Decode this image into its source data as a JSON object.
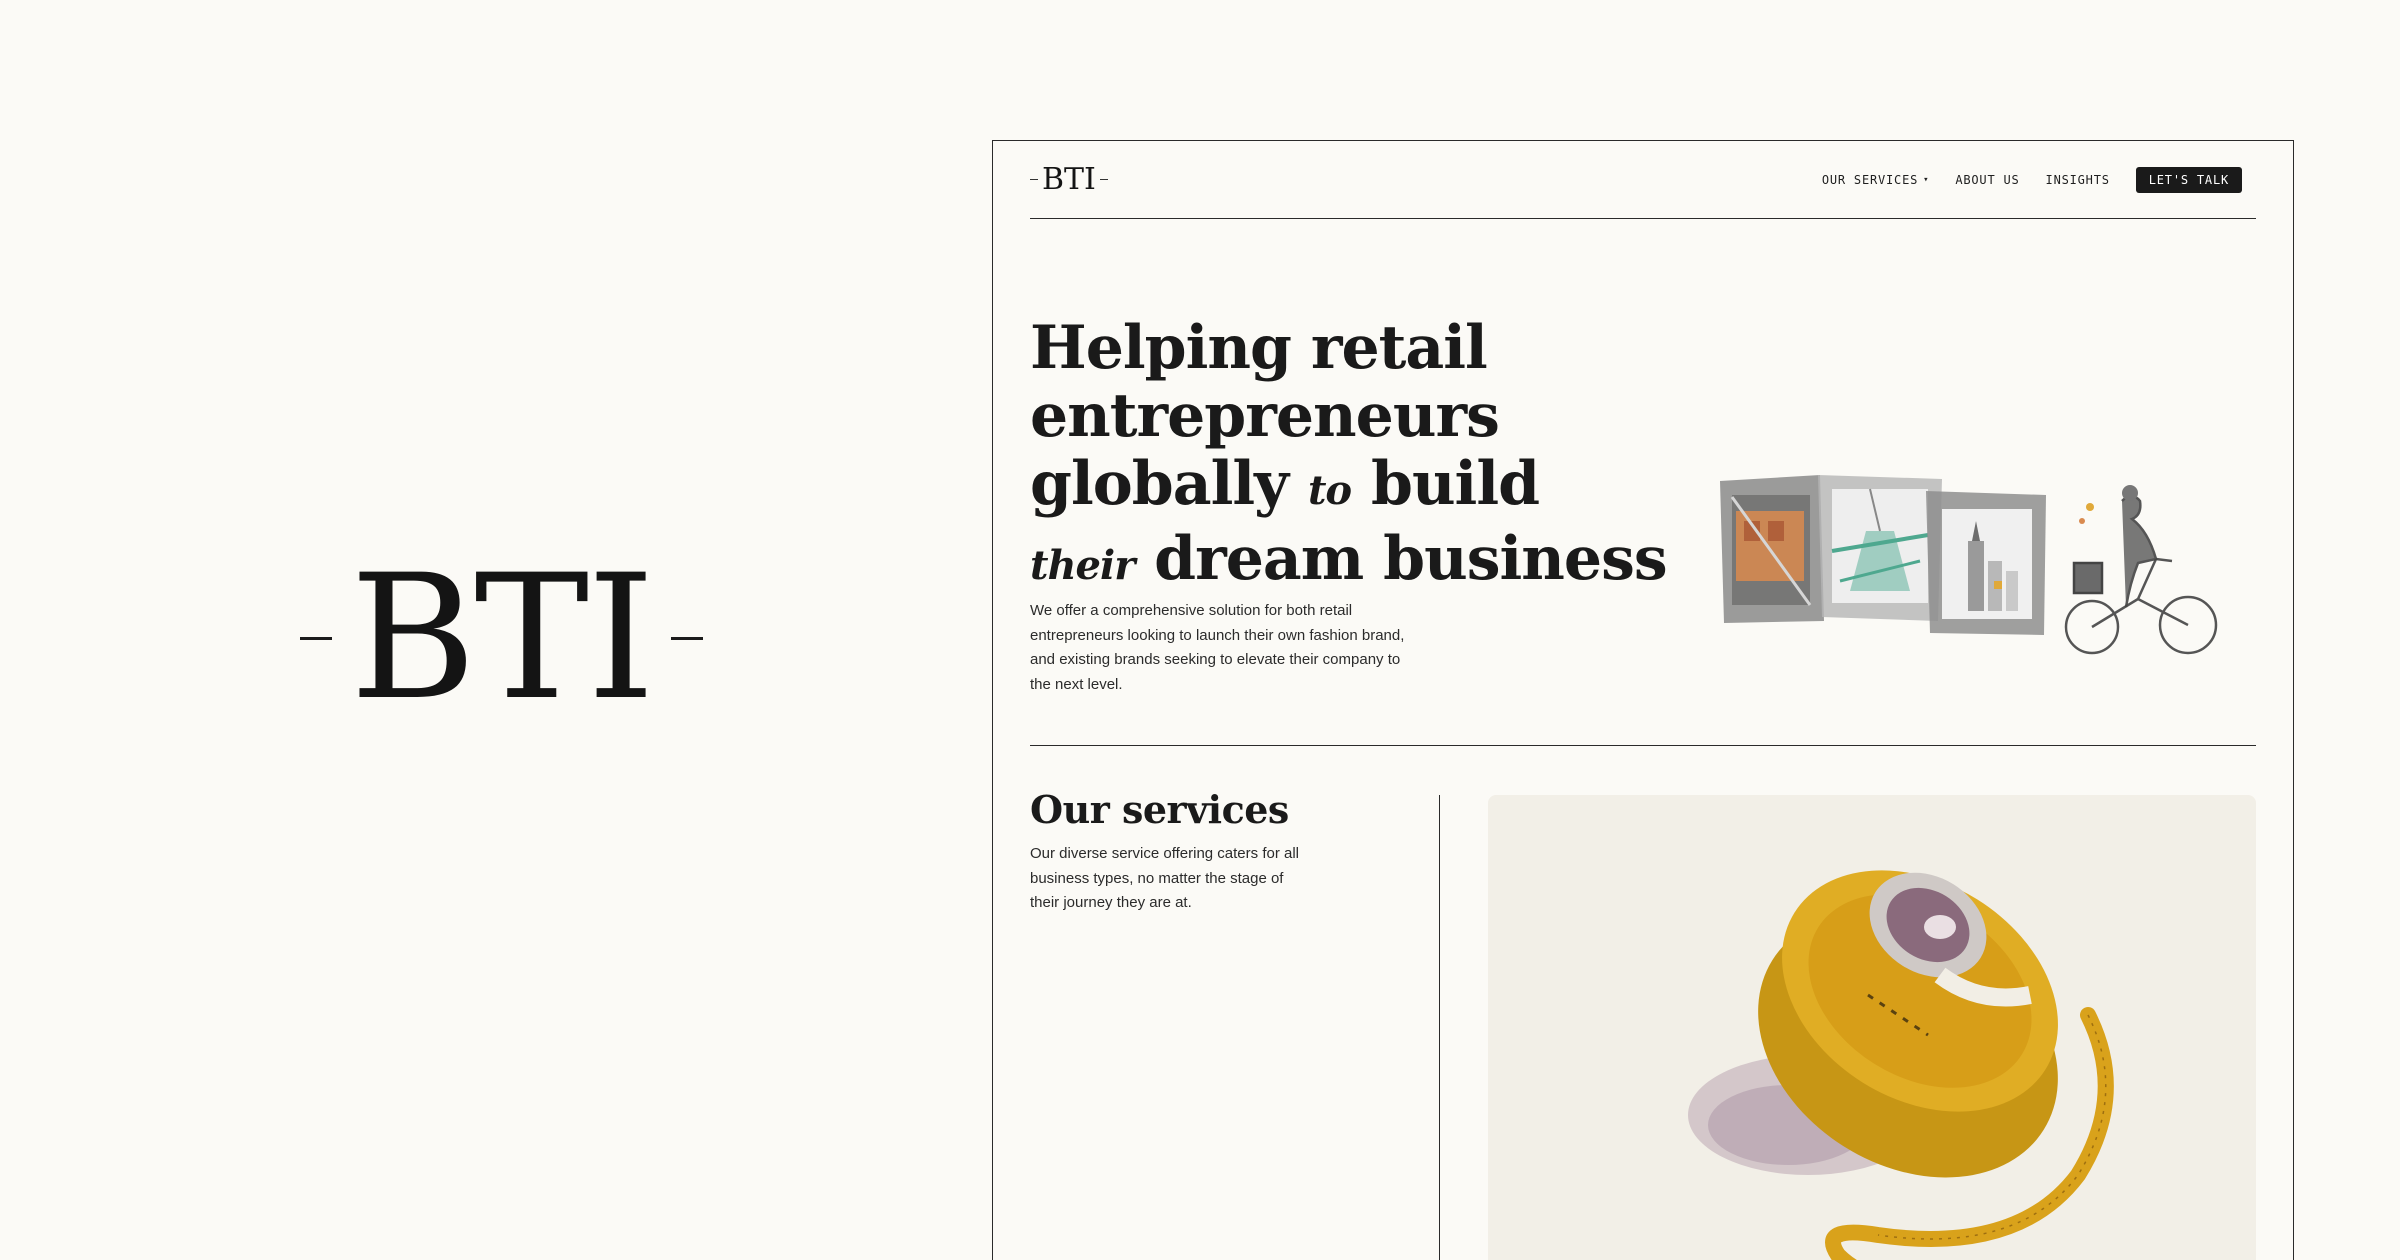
{
  "brand": {
    "name": "BTI"
  },
  "header": {
    "logo": "BTI",
    "nav": {
      "services": "OUR SERVICES",
      "about": "ABOUT US",
      "insights": "INSIGHTS",
      "cta": "LET'S TALK"
    }
  },
  "hero": {
    "line1": "Helping retail",
    "line2": "entrepreneurs",
    "line3_a": "globally",
    "line3_italic": "to",
    "line3_b": "build",
    "line4_italic": "their",
    "line4_b": "dream business",
    "description": "We offer a comprehensive solution for both retail entrepreneurs looking to launch their own fashion brand, and existing brands seeking to elevate their company to the next level.",
    "illustration": "watercolor-city-frames-and-cyclist"
  },
  "services": {
    "title": "Our services",
    "description": "Our diverse service offering caters for all business types, no matter the stage of their journey they are at.",
    "illustration": "watercolor-tape-measure"
  },
  "colors": {
    "background": "#fbfaf6",
    "text": "#1b1b1b",
    "cta_bg": "#1a1a1a",
    "accent_yellow": "#d9a21b",
    "accent_orange": "#d98a4f"
  }
}
